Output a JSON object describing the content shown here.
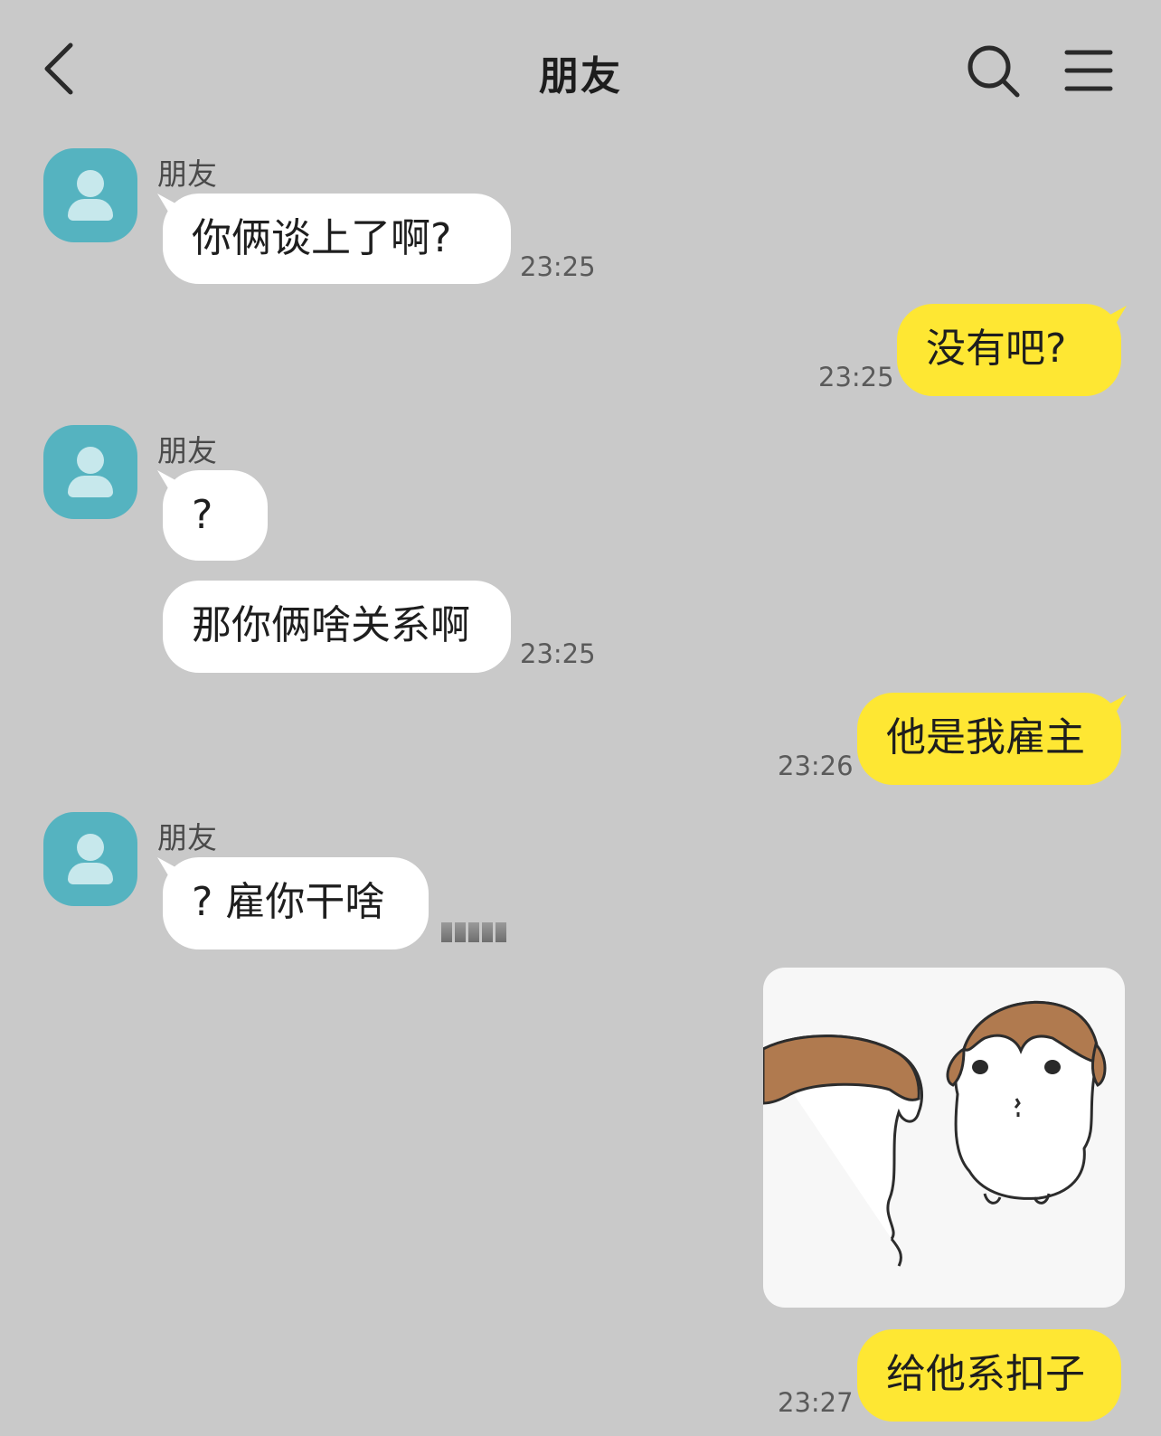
{
  "header": {
    "title": "朋友",
    "back_icon": "chevron-left-icon",
    "search_icon": "search-icon",
    "menu_icon": "hamburger-menu-icon"
  },
  "colors": {
    "background": "#c9c9c9",
    "incoming_bubble": "#ffffff",
    "outgoing_bubble": "#fee733",
    "avatar": "#55b3c0"
  },
  "messages": {
    "m1_sender": "朋友",
    "m1_text": "你俩谈上了啊?",
    "m1_time": "23:25",
    "m2_text": "没有吧?",
    "m2_time": "23:25",
    "m3_sender": "朋友",
    "m3_text": "?",
    "m4_text": "那你俩啥关系啊",
    "m4_time": "23:25",
    "m5_text": "他是我雇主",
    "m5_time": "23:26",
    "m6_sender": "朋友",
    "m6_text": "? 雇你干啥",
    "m7_sticker": "two-puppies-sticker",
    "m8_text": "给他系扣子",
    "m8_time": "23:27"
  }
}
